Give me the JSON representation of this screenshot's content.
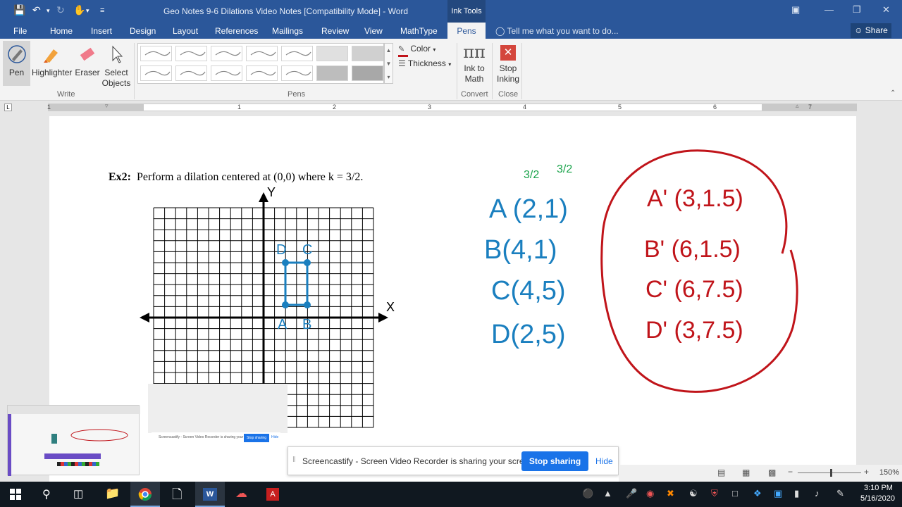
{
  "window": {
    "title": "Geo Notes 9-6 Dilations Video Notes [Compatibility Mode] - Word",
    "context_tab": "Ink Tools"
  },
  "tabs": [
    "File",
    "Home",
    "Insert",
    "Design",
    "Layout",
    "References",
    "Mailings",
    "Review",
    "View",
    "MathType",
    "Pens"
  ],
  "tell_me": "Tell me what you want to do...",
  "share": "Share",
  "ribbon": {
    "write": {
      "pen": "Pen",
      "highlighter": "Highlighter",
      "eraser": "Eraser",
      "select_line1": "Select",
      "select_line2": "Objects",
      "group": "Write"
    },
    "pens_group": "Pens",
    "color": "Color",
    "thickness": "Thickness",
    "convert": {
      "line1": "Ink to",
      "line2": "Math",
      "group": "Convert"
    },
    "close": {
      "line1": "Stop",
      "line2": "Inking",
      "group": "Close"
    }
  },
  "ruler_numbers": [
    "1",
    "1",
    "2",
    "3",
    "4",
    "5",
    "6",
    "7"
  ],
  "document": {
    "example_label": "Ex2:",
    "example_text": "Perform a dilation centered at (0,0) where k = 3/2.",
    "axis_x": "X",
    "axis_y": "Y",
    "graph_points": [
      "A",
      "B",
      "C",
      "D"
    ],
    "scale_notes": [
      "3/2",
      "3/2"
    ],
    "original_points": [
      "A (2,1)",
      "B(4,1)",
      "C(4,5)",
      "D(2,5)"
    ],
    "image_points": [
      "A' (3,1.5)",
      "B' (6,1.5)",
      "C' (6,7.5)",
      "D' (3,7.5)"
    ]
  },
  "share_bar": {
    "text": "Screencastify - Screen Video Recorder is sharing your screen.",
    "stop": "Stop sharing",
    "hide": "Hide"
  },
  "mini_share": {
    "text": "Screencastify - Screen Video Recorder is sharing your screen",
    "stop": "Stop sharing",
    "hide": "Hide"
  },
  "statusbar": {
    "zoom": "150%"
  },
  "clock": {
    "time": "3:10 PM",
    "date": "5/16/2020"
  },
  "colors": {
    "word_blue": "#2b579a",
    "ink_blue": "#1a7fbf",
    "ink_red": "#c0141a",
    "ink_green": "#19a34a",
    "share_blue": "#1a73e8"
  }
}
